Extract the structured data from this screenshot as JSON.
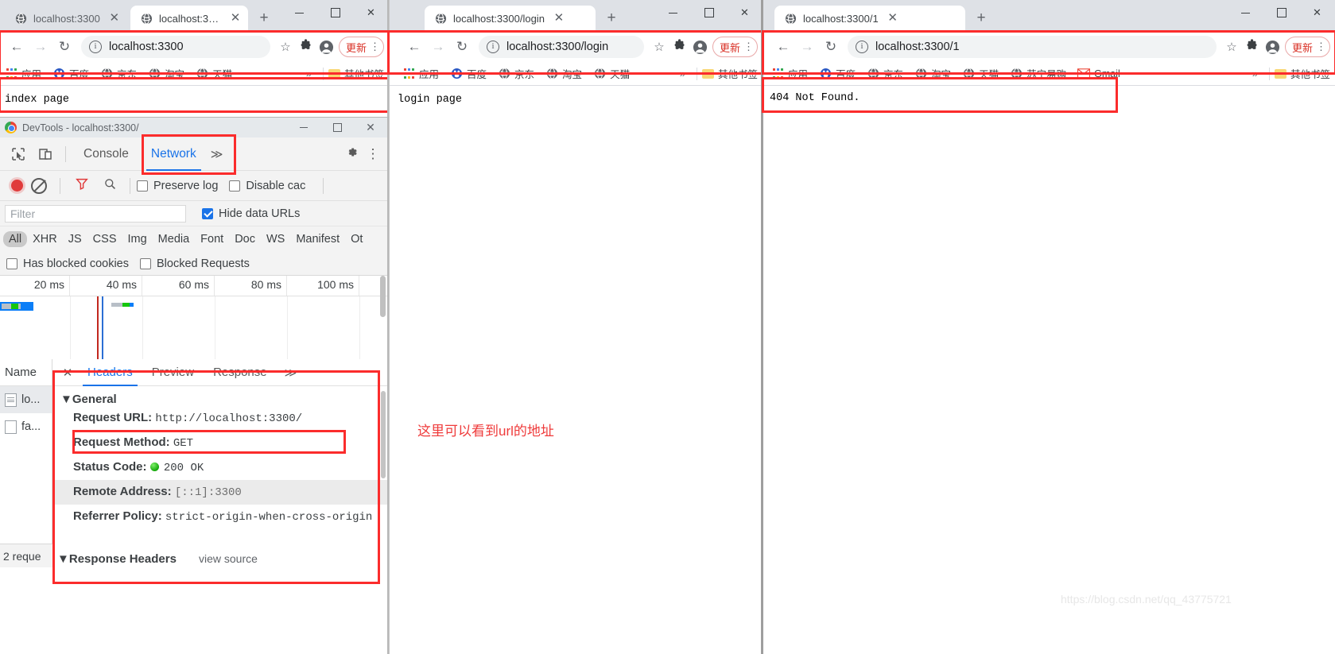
{
  "windows": [
    {
      "id": "window-index",
      "tabs": [
        {
          "title": "localhost:3300",
          "active": false
        },
        {
          "title": "localhost:3300",
          "active": true
        }
      ],
      "newtab_label": "+",
      "controls": {
        "minimize": "—",
        "maximize": "□",
        "close": "✕"
      },
      "toolbar": {
        "back": "←",
        "forward": "→",
        "reload": "↻",
        "info": "i",
        "url_scheme": "",
        "url": "localhost:3300",
        "star": "☆",
        "extensions": "✻",
        "update_label": "更新",
        "kebab": "⋮"
      },
      "bookmarks": {
        "apps_label": "应用",
        "items": [
          {
            "label": "百度",
            "icon": "baidu-icon"
          },
          {
            "label": "京东",
            "icon": "globe-icon"
          },
          {
            "label": "淘宝",
            "icon": "globe-icon"
          },
          {
            "label": "天猫",
            "icon": "globe-icon"
          }
        ],
        "overflow": "»",
        "other_label": "其他书签"
      },
      "page_text": "index page"
    },
    {
      "id": "window-login",
      "tabs": [
        {
          "title": "localhost:3300/login",
          "active": true
        }
      ],
      "newtab_label": "+",
      "controls": {
        "minimize": "—",
        "maximize": "□",
        "close": "✕"
      },
      "toolbar": {
        "back": "←",
        "forward": "→",
        "reload": "↻",
        "info": "i",
        "url": "localhost:3300/login",
        "star": "☆",
        "extensions": "✻",
        "update_label": "更新",
        "kebab": "⋮"
      },
      "bookmarks": {
        "apps_label": "应用",
        "items": [
          {
            "label": "百度",
            "icon": "baidu-icon"
          },
          {
            "label": "京东",
            "icon": "globe-icon"
          },
          {
            "label": "淘宝",
            "icon": "globe-icon"
          },
          {
            "label": "天猫",
            "icon": "globe-icon"
          }
        ],
        "overflow": "»",
        "other_label": "其他书签"
      },
      "page_text": "login page"
    },
    {
      "id": "window-404",
      "tabs": [
        {
          "title": "localhost:3300/1",
          "active": true
        }
      ],
      "newtab_label": "+",
      "controls": {
        "minimize": "—",
        "maximize": "□",
        "close": "✕"
      },
      "toolbar": {
        "back": "←",
        "forward": "→",
        "reload": "↻",
        "info": "i",
        "url": "localhost:3300/1",
        "star": "☆",
        "extensions": "✻",
        "update_label": "更新",
        "kebab": "⋮"
      },
      "bookmarks": {
        "apps_label": "应用",
        "items": [
          {
            "label": "百度",
            "icon": "baidu-icon"
          },
          {
            "label": "京东",
            "icon": "globe-icon"
          },
          {
            "label": "淘宝",
            "icon": "globe-icon"
          },
          {
            "label": "天猫",
            "icon": "globe-icon"
          },
          {
            "label": "苏宁易购",
            "icon": "globe-icon"
          },
          {
            "label": "Gmail",
            "icon": "gmail-icon"
          }
        ],
        "overflow": "»",
        "other_label": "其他书签"
      },
      "page_text": "404 Not Found."
    }
  ],
  "devtools": {
    "window_title": "DevTools - localhost:3300/",
    "controls": {
      "minimize": "—",
      "maximize": "□",
      "close": "✕"
    },
    "panel_tabs": [
      {
        "label": "Console",
        "selected": false
      },
      {
        "label": "Network",
        "selected": true
      }
    ],
    "panel_overflow": "≫",
    "gear": "⚙",
    "kebab": "⋮",
    "controls_bar": {
      "record_title": "record",
      "clear_title": "clear",
      "filter_title": "filter",
      "search_title": "search",
      "preserve_log": "Preserve log",
      "disable_cache": "Disable cac"
    },
    "filter": {
      "placeholder": "Filter",
      "value": "",
      "hide_data_urls": "Hide data URLs",
      "hide_data_urls_checked": true
    },
    "resource_types": [
      "All",
      "XHR",
      "JS",
      "CSS",
      "Img",
      "Media",
      "Font",
      "Doc",
      "WS",
      "Manifest",
      "Ot"
    ],
    "resource_types_selected": "All",
    "blocked_filters": [
      {
        "label": "Has blocked cookies",
        "checked": false
      },
      {
        "label": "Blocked Requests",
        "checked": false
      }
    ],
    "waterfall_ticks": [
      "20 ms",
      "40 ms",
      "60 ms",
      "80 ms",
      "100 ms"
    ],
    "requests_column_header": "Name",
    "requests": [
      {
        "name": "lo...",
        "icon": "document-icon",
        "selected": true
      },
      {
        "name": "fa...",
        "icon": "blank-document-icon",
        "selected": false
      }
    ],
    "status_text": "2 reque",
    "detail_tabs": [
      {
        "label": "Headers",
        "selected": true
      },
      {
        "label": "Preview",
        "selected": false
      },
      {
        "label": "Response",
        "selected": false
      }
    ],
    "detail_overflow": "≫",
    "detail_close": "✕",
    "general_section": {
      "title": "General",
      "collapse_arrow": "▼",
      "rows": [
        {
          "key": "Request URL:",
          "value": "http://localhost:3300/",
          "highlight": false
        },
        {
          "key": "Request Method:",
          "value": "GET",
          "highlight": false
        },
        {
          "key": "Status Code:",
          "value": "200 OK",
          "status_dot": true,
          "highlight": false
        },
        {
          "key": "Remote Address:",
          "value": "[::1]:3300",
          "highlight": true
        },
        {
          "key": "Referrer Policy:",
          "value": "strict-origin-when-cross-origin",
          "highlight": false
        }
      ]
    },
    "response_headers_title": "Response Headers",
    "response_headers_viewsource": "view source"
  },
  "annotation": {
    "text": "这里可以看到url的地址",
    "color": "#ef3b3b"
  },
  "watermark": "https://blog.csdn.net/qq_43775721",
  "colors": {
    "annotation_red": "#fb2c2c",
    "chrome_tabstrip": "#dee1e6",
    "devtools_accent": "#1a73e8",
    "update_red": "#d93025"
  }
}
